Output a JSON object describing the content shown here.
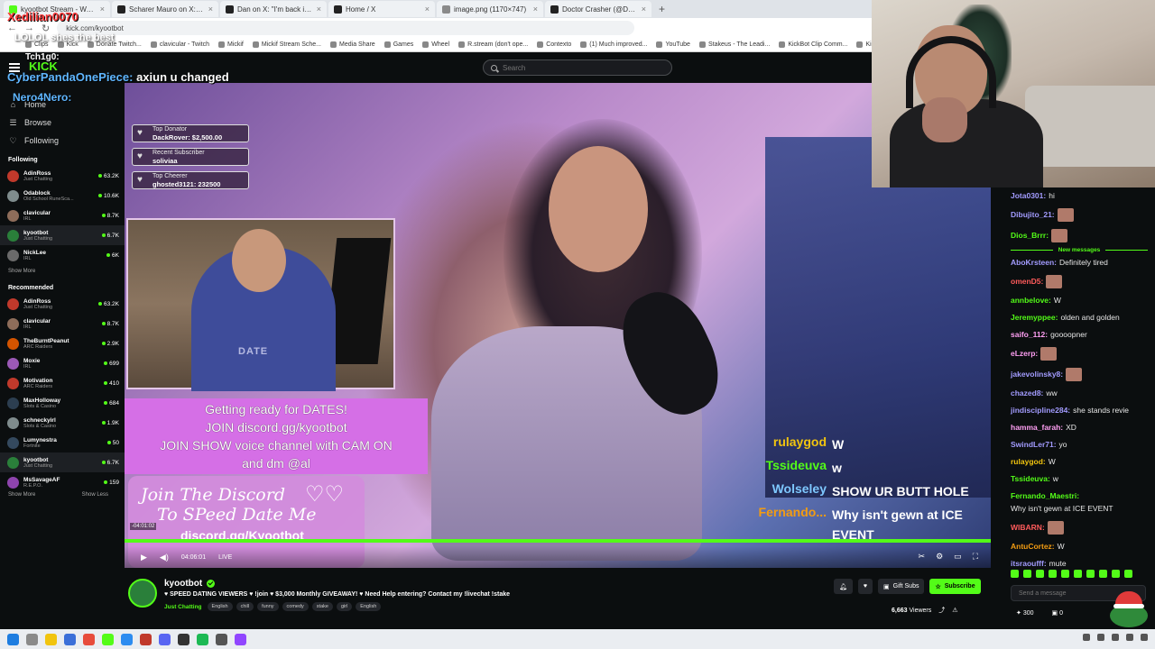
{
  "browser": {
    "tabs": [
      {
        "title": "kyootbot Stream - Watch L...",
        "color": "#53fc18"
      },
      {
        "title": "Scharer Mauro on X: \"https://...",
        "color": "#222222"
      },
      {
        "title": "Dan on X: \"I'm back in the FUC...",
        "color": "#222222"
      },
      {
        "title": "Home / X",
        "color": "#222222"
      },
      {
        "title": "image.png (1170×747)",
        "color": "#8a8a8a"
      },
      {
        "title": "Doctor Crasher (@DoctorCrash...",
        "color": "#222222"
      }
    ],
    "new_tab": "+",
    "url": "kick.com/kyootbot",
    "bookmarks": [
      "Clips",
      "Kick",
      "Donate Twitch...",
      "clavicular - Twitch",
      "Mickif",
      "Mickif Stream Sche...",
      "Media Share",
      "Games",
      "Wheel",
      "R.stream (don't ope...",
      "Contexto",
      "(1) Much improved...",
      "YouTube",
      "Stakeus - The Leadi...",
      "KickBot Clip Comm...",
      "Kickaway - Kick Gi..."
    ]
  },
  "overlay": {
    "top_name": "Xedilian0070",
    "lol_text": "LOLOL shes the best",
    "follow_name": "Tch1g0:",
    "kick_text": "KICK",
    "chat_user": "CyberPandaOnePiece:",
    "chat_text": "axiun u changed",
    "name3": "Nero4Nero:"
  },
  "header": {
    "search_placeholder": "Search"
  },
  "sidebar": {
    "nav": [
      {
        "icon": "home-icon",
        "glyph": "⌂",
        "label": "Home"
      },
      {
        "icon": "compass-icon",
        "glyph": "☰",
        "label": "Browse"
      },
      {
        "icon": "heart-icon",
        "glyph": "♡",
        "label": "Following"
      }
    ],
    "following_title": "Following",
    "following": [
      {
        "name": "AdinRoss",
        "category": "Just Chatting",
        "viewers": "63.2K",
        "color": "#c0392b"
      },
      {
        "name": "Odablock",
        "category": "Old School RuneSca...",
        "viewers": "10.6K",
        "color": "#7f8c8d"
      },
      {
        "name": "clavicular",
        "category": "IRL",
        "viewers": "8.7K",
        "color": "#8e6d5a"
      },
      {
        "name": "kyootbot",
        "category": "Just Chatting",
        "viewers": "6.7K",
        "color": "#2a7f3a"
      },
      {
        "name": "NickLee",
        "category": "IRL",
        "viewers": "6K",
        "color": "#6a6a6a"
      }
    ],
    "show_more_1": "Show More",
    "recommended_title": "Recommended",
    "recommended": [
      {
        "name": "AdinRoss",
        "category": "Just Chatting",
        "viewers": "63.2K",
        "color": "#c0392b"
      },
      {
        "name": "clavicular",
        "category": "IRL",
        "viewers": "8.7K",
        "color": "#8e6d5a"
      },
      {
        "name": "TheBurntPeanut",
        "category": "ARC Raiders",
        "viewers": "2.9K",
        "color": "#d35400"
      },
      {
        "name": "Moxie",
        "category": "IRL",
        "viewers": "699",
        "color": "#9b59b6"
      },
      {
        "name": "Motivation",
        "category": "ARC Raiders",
        "viewers": "410",
        "color": "#c0392b"
      },
      {
        "name": "MaxHolloway",
        "category": "Slots & Casino",
        "viewers": "684",
        "color": "#2c3e50"
      },
      {
        "name": "schneckyirl",
        "category": "Slots & Casino",
        "viewers": "1.9K",
        "color": "#7f8c8d"
      },
      {
        "name": "Lumynestra",
        "category": "Fortnite",
        "viewers": "50",
        "color": "#34495e"
      },
      {
        "name": "kyootbot",
        "category": "Just Chatting",
        "viewers": "6.7K",
        "color": "#2a7f3a"
      },
      {
        "name": "MsSavageAF",
        "category": "R.E.P.O.",
        "viewers": "159",
        "color": "#8e44ad"
      }
    ],
    "show_more_2": "Show More",
    "show_less": "Show Less"
  },
  "video": {
    "donors": [
      {
        "label": "Top Donator",
        "value": "DackRover: $2,500.00"
      },
      {
        "label": "Recent Subscriber",
        "value": "soliviaa"
      },
      {
        "label": "Top Cheerer",
        "value": "ghosted3121: 232500"
      }
    ],
    "cam_label": "DATE",
    "pink_lines": [
      "Getting ready for DATES!",
      "JOIN discord.gg/kyootbot",
      "JOIN SHOW voice channel with CAM ON",
      "and dm @al"
    ],
    "discord_line1": "Join The Discord",
    "discord_line2": "To SPeed Date Me",
    "discord_line3": "discord.gg/Kyootbot",
    "onscreen_chat": [
      {
        "name": "rulaygod",
        "msg": "W",
        "color": "#f1c40f"
      },
      {
        "name": "Tssideuva",
        "msg": "w",
        "color": "#53fc18"
      },
      {
        "name": "Wolseley",
        "msg": "SHOW UR BUTT HOLE",
        "color": "#7ec8ff"
      },
      {
        "name": "Fernando...",
        "msg": "Why isn't gewn at ICE EVENT",
        "color": "#f39c12"
      }
    ],
    "seek_time": "-04:01:02",
    "time": "04:06:01",
    "live": "LIVE"
  },
  "chat": {
    "messages_before": [
      {
        "user": "Jota0301:",
        "text": "hi",
        "color": "#a29bfe",
        "emote": false
      },
      {
        "user": "Dibujito_21:",
        "text": "",
        "color": "#a29bfe",
        "emote": true
      },
      {
        "user": "Dios_Brrr:",
        "text": "",
        "color": "#53fc18",
        "emote": true
      }
    ],
    "new_messages": "New messages",
    "messages_after": [
      {
        "user": "AboKrsteen:",
        "text": "Definitely tired",
        "color": "#a29bfe",
        "emote": false
      },
      {
        "user": "omenD5:",
        "text": "",
        "color": "#ff5b5b",
        "emote": true
      },
      {
        "user": "annbelove:",
        "text": "W",
        "color": "#53fc18",
        "emote": false
      },
      {
        "user": "Jeremyppee:",
        "text": "olden and golden",
        "color": "#53fc18",
        "emote": false
      },
      {
        "user": "saifo_112:",
        "text": "goooopner",
        "color": "#ff9ff3",
        "emote": false
      },
      {
        "user": "eLzerp:",
        "text": "",
        "color": "#ff9ff3",
        "emote": true
      },
      {
        "user": "jakevolinsky8:",
        "text": "",
        "color": "#a29bfe",
        "emote": true
      },
      {
        "user": "chazed8:",
        "text": "ww",
        "color": "#a29bfe",
        "emote": false
      },
      {
        "user": "jindiscipline284:",
        "text": "she stands revie",
        "color": "#a29bfe",
        "emote": false
      },
      {
        "user": "hamma_farah:",
        "text": "XD",
        "color": "#ff9ff3",
        "emote": false
      },
      {
        "user": "SwindLer71:",
        "text": "yo",
        "color": "#a29bfe",
        "emote": false
      },
      {
        "user": "rulaygod:",
        "text": "W",
        "color": "#f1c40f",
        "emote": false
      },
      {
        "user": "Tssideuva:",
        "text": "w",
        "color": "#53fc18",
        "emote": false
      },
      {
        "user": "Fernando_Maestri:",
        "text": "Why isn't gewn at ICE EVENT",
        "color": "#53fc18",
        "emote": false
      },
      {
        "user": "WIBARN:",
        "text": "",
        "color": "#ff5b5b",
        "emote": true
      },
      {
        "user": "AntuCortez:",
        "text": "W",
        "color": "#f39c12",
        "emote": false
      },
      {
        "user": "itsraoufff:",
        "text": "mute",
        "color": "#a29bfe",
        "emote": false
      }
    ],
    "input_placeholder": "Send a message",
    "points": "300",
    "gifts": "0"
  },
  "stream_info": {
    "name": "kyootbot",
    "title": "♥ SPEED DATING VIEWERS ♥ !join ♥ $3,000 Monthly GIVEAWAY! ♥ Need Help entering? Contact my !livechat !stake",
    "category": "Just Chatting",
    "tags": [
      "English",
      "chill",
      "funny",
      "comedy",
      "stake",
      "girl",
      "English"
    ],
    "gift_subs": "Gift Subs",
    "subscribe": "Subscribe",
    "viewers": "6,663",
    "viewers_label": "Viewers"
  },
  "colors": {
    "kick_green": "#53fc18",
    "background": "#0b0e0f"
  }
}
